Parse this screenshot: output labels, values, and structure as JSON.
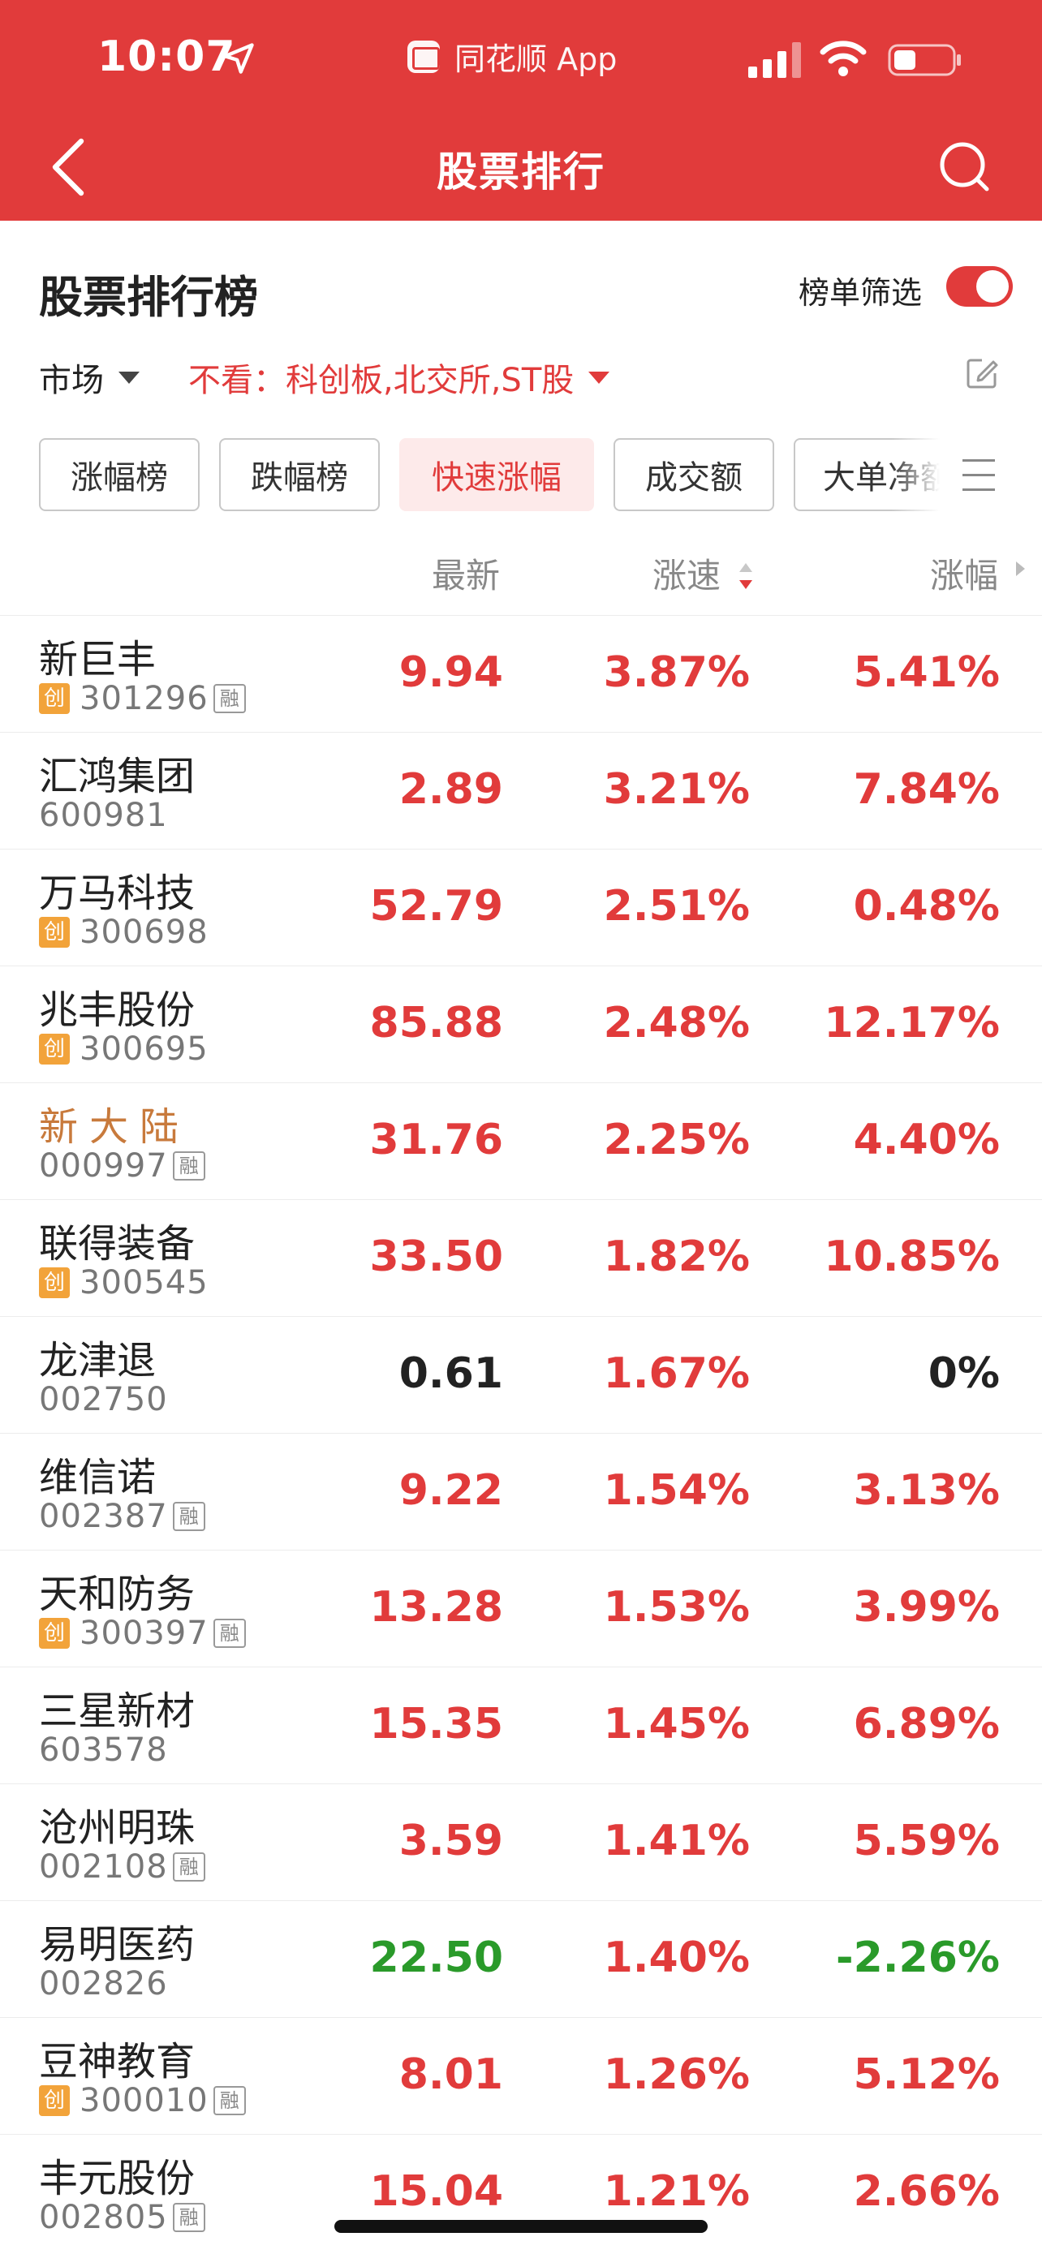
{
  "status_bar": {
    "time": "10:07",
    "app_name": "同花顺 App"
  },
  "nav": {
    "title": "股票排行",
    "back_icon": "chevron-left-icon",
    "search_icon": "search-icon"
  },
  "header": {
    "title": "股票排行榜",
    "filter_label": "榜单筛选",
    "filter_enabled": true
  },
  "filters": {
    "market_label": "市场",
    "exclude_text": "不看：科创板,北交所,ST股"
  },
  "tabs": [
    {
      "label": "涨幅榜",
      "active": false
    },
    {
      "label": "跌幅榜",
      "active": false
    },
    {
      "label": "快速涨幅",
      "active": true
    },
    {
      "label": "成交额",
      "active": false
    },
    {
      "label": "大单净额",
      "active": false
    }
  ],
  "columns": {
    "latest": "最新",
    "speed": "涨速",
    "change": "涨幅"
  },
  "colors": {
    "brand_red": "#e13b3b",
    "up_red": "#e13b3b",
    "down_green": "#2a9a2a",
    "chuang_badge": "#f2a33a"
  },
  "stocks": [
    {
      "name": "新巨丰",
      "code": "301296",
      "chuang": true,
      "rong": true,
      "price": "9.94",
      "speed": "3.87%",
      "change": "5.41%"
    },
    {
      "name": "汇鸿集团",
      "code": "600981",
      "chuang": false,
      "rong": false,
      "price": "2.89",
      "speed": "3.21%",
      "change": "7.84%"
    },
    {
      "name": "万马科技",
      "code": "300698",
      "chuang": true,
      "rong": false,
      "price": "52.79",
      "speed": "2.51%",
      "change": "0.48%"
    },
    {
      "name": "兆丰股份",
      "code": "300695",
      "chuang": true,
      "rong": false,
      "price": "85.88",
      "speed": "2.48%",
      "change": "12.17%"
    },
    {
      "name": "新大陆",
      "code": "000997",
      "chuang": false,
      "rong": true,
      "price": "31.76",
      "speed": "2.25%",
      "change": "4.40%"
    },
    {
      "name": "联得装备",
      "code": "300545",
      "chuang": true,
      "rong": false,
      "price": "33.50",
      "speed": "1.82%",
      "change": "10.85%"
    },
    {
      "name": "龙津退",
      "code": "002750",
      "chuang": false,
      "rong": false,
      "price": "0.61",
      "speed": "1.67%",
      "change": "0%"
    },
    {
      "name": "维信诺",
      "code": "002387",
      "chuang": false,
      "rong": true,
      "price": "9.22",
      "speed": "1.54%",
      "change": "3.13%"
    },
    {
      "name": "天和防务",
      "code": "300397",
      "chuang": true,
      "rong": true,
      "price": "13.28",
      "speed": "1.53%",
      "change": "3.99%"
    },
    {
      "name": "三星新材",
      "code": "603578",
      "chuang": false,
      "rong": false,
      "price": "15.35",
      "speed": "1.45%",
      "change": "6.89%"
    },
    {
      "name": "沧州明珠",
      "code": "002108",
      "chuang": false,
      "rong": true,
      "price": "3.59",
      "speed": "1.41%",
      "change": "5.59%"
    },
    {
      "name": "易明医药",
      "code": "002826",
      "chuang": false,
      "rong": false,
      "price": "22.50",
      "speed": "1.40%",
      "change": "-2.26%"
    },
    {
      "name": "豆神教育",
      "code": "300010",
      "chuang": true,
      "rong": true,
      "price": "8.01",
      "speed": "1.26%",
      "change": "5.12%"
    },
    {
      "name": "丰元股份",
      "code": "002805",
      "chuang": false,
      "rong": true,
      "price": "15.04",
      "speed": "1.21%",
      "change": "2.66%"
    }
  ],
  "badges": {
    "chuang": "创",
    "rong": "融"
  }
}
